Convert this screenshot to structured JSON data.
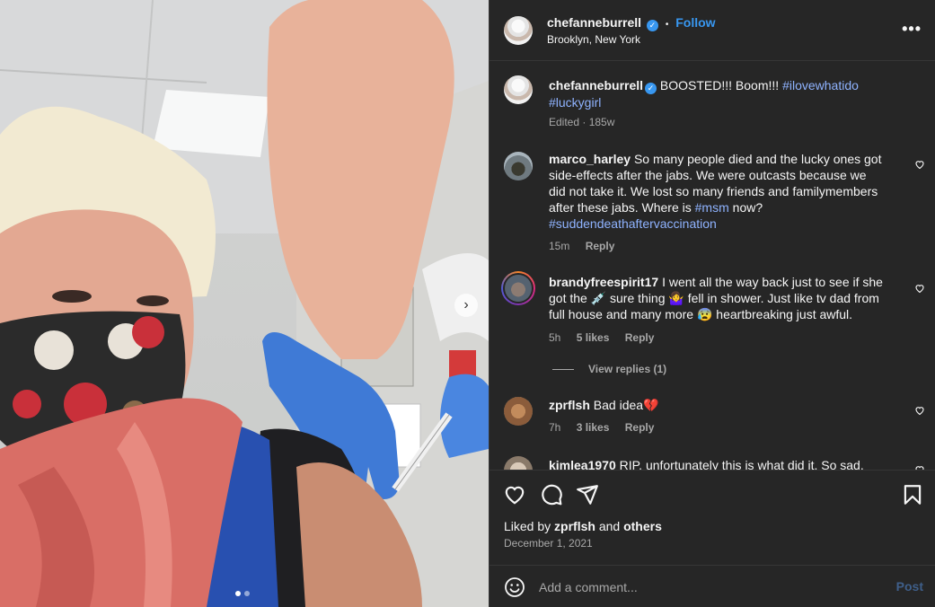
{
  "post": {
    "author": "chefanneburrell",
    "follow_label": "Follow",
    "location": "Brooklyn, New York",
    "dot": "•",
    "more_label": "•••",
    "caption": {
      "username": "chefanneburrell",
      "text": "BOOSTED!!! Boom!!!",
      "tag1": "#ilovewhatido",
      "tag2": "#luckygirl",
      "meta": "Edited · 185w"
    }
  },
  "comments": [
    {
      "username": "marco_harley",
      "text_1": "So many people died and the lucky ones got",
      "text_2": "side-effects after the jabs. We were outcasts because we",
      "text_3": "did not take it. We lost so many friends and familymembers",
      "text_4": "after these jabs. Where is",
      "tag1": "#msm",
      "text_5": "now?",
      "tag2": "#suddendeathaftervaccination",
      "time": "15m",
      "reply": "Reply"
    },
    {
      "username": "brandyfreespirit17",
      "text_1": "I went all the way back just to see if she",
      "text_2": "got the 💉 sure thing 🤷‍♀️ fell in shower. Just like tv dad from",
      "text_3": "full house and many more 😰 heartbreaking just awful.",
      "time": "5h",
      "likes": "5 likes",
      "reply": "Reply",
      "view_replies": "View replies (1)"
    },
    {
      "username": "zprflsh",
      "text": "Bad idea💔",
      "time": "7h",
      "likes": "3 likes",
      "reply": "Reply"
    },
    {
      "username": "kimlea1970",
      "text": "RIP. unfortunately this is what did it. So sad."
    }
  ],
  "footer": {
    "liked_prefix": "Liked by",
    "liked_user": "zprflsh",
    "liked_and": "and",
    "liked_others": "others",
    "date": "December 1, 2021",
    "add_comment_placeholder": "Add a comment...",
    "post_label": "Post"
  },
  "photo": {
    "next_arrow": "›",
    "carousel_count": 2,
    "carousel_active": 1
  },
  "colors": {
    "panel_bg": "#262626",
    "link_blue": "#3897f0",
    "hashtag": "#8fb3ff",
    "muted": "#a8a8a8",
    "post_disabled": "#3f5f8a"
  }
}
